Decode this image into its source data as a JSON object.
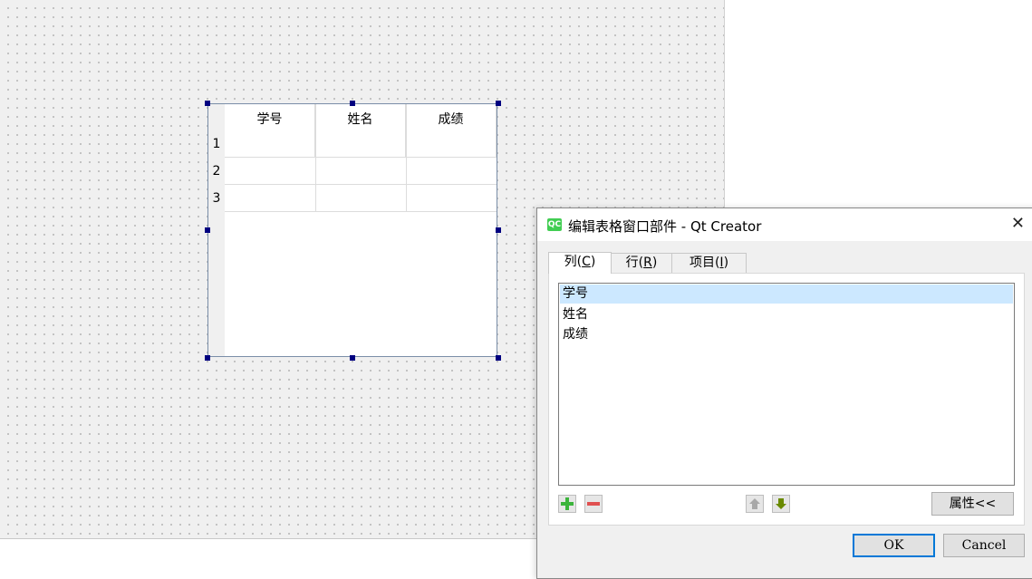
{
  "table_widget": {
    "columns": [
      "学号",
      "姓名",
      "成绩"
    ],
    "rows": [
      "1",
      "2",
      "3"
    ]
  },
  "dialog": {
    "title": "编辑表格窗口部件 - Qt Creator",
    "logo_text": "QC",
    "close_glyph": "✕",
    "tabs": [
      {
        "label": "列",
        "mnemonic": "C"
      },
      {
        "label": "行",
        "mnemonic": "R"
      },
      {
        "label": "项目",
        "mnemonic": "I"
      }
    ],
    "items": [
      "学号",
      "姓名",
      "成绩"
    ],
    "selected_index": 0,
    "properties_button": "属性<<",
    "ok_button": "OK",
    "cancel_button": "Cancel"
  },
  "colors": {
    "selection": "#cce8ff",
    "add_icon": "#3cb43c",
    "remove_icon": "#e05050",
    "arrow_down_icon": "#6a8a00",
    "default_button_border": "#0078d7",
    "handle": "#000080"
  }
}
